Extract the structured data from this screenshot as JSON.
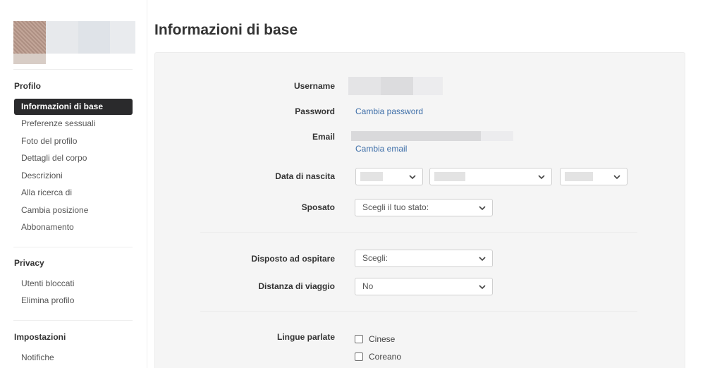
{
  "sidebar": {
    "sections": [
      {
        "title": "Profilo",
        "items": [
          {
            "label": "Informazioni di base",
            "active": true
          },
          {
            "label": "Preferenze sessuali"
          },
          {
            "label": "Foto del profilo"
          },
          {
            "label": "Dettagli del corpo"
          },
          {
            "label": "Descrizioni"
          },
          {
            "label": "Alla ricerca di"
          },
          {
            "label": "Cambia posizione"
          },
          {
            "label": "Abbonamento"
          }
        ]
      },
      {
        "title": "Privacy",
        "items": [
          {
            "label": "Utenti bloccati"
          },
          {
            "label": "Elimina profilo"
          }
        ]
      },
      {
        "title": "Impostazioni",
        "items": [
          {
            "label": "Notifiche"
          }
        ]
      }
    ]
  },
  "main": {
    "title": "Informazioni di base",
    "fields": {
      "username": {
        "label": "Username"
      },
      "password": {
        "label": "Password",
        "link": "Cambia password"
      },
      "email": {
        "label": "Email",
        "link": "Cambia email"
      },
      "birthdate": {
        "label": "Data di nascita"
      },
      "married": {
        "label": "Sposato",
        "value": "Scegli il tuo stato:"
      },
      "host": {
        "label": "Disposto ad ospitare",
        "value": "Scegli:"
      },
      "travel": {
        "label": "Distanza di viaggio",
        "value": "No"
      },
      "languages": {
        "label": "Lingue parlate",
        "options": [
          {
            "label": "Cinese",
            "checked": false
          },
          {
            "label": "Coreano",
            "checked": false
          }
        ]
      }
    }
  },
  "colors": {
    "accent_link": "#3d6ea8",
    "active_nav_bg": "#2a2a2c",
    "panel_bg": "#f5f5f5"
  },
  "icons": {
    "select_arrow": "chevron-down-icon",
    "checkbox": "checkbox-unchecked"
  }
}
